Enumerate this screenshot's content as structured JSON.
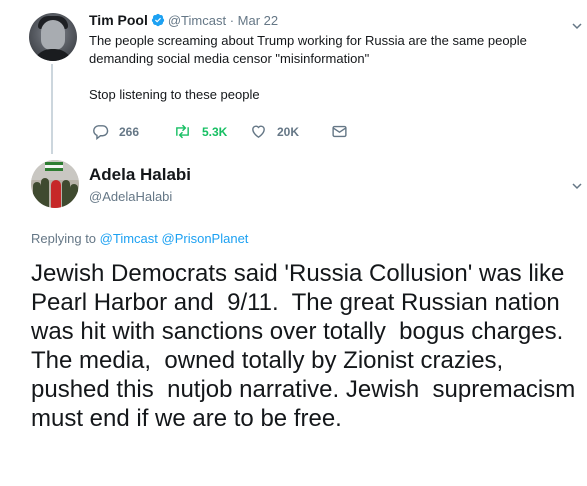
{
  "parent_tweet": {
    "author_name": "Tim Pool",
    "handle": "@Timcast",
    "separator": "·",
    "date": "Mar 22",
    "text_line1": "The people screaming about Trump working for Russia are the same people",
    "text_line2": "demanding social media censor \"misinformation\"",
    "text_line3": "Stop listening to these people",
    "replies": "266",
    "retweets": "5.3K",
    "likes": "20K",
    "verified_color": "#1da1f2",
    "retweet_color": "#17bf63"
  },
  "reply_tweet": {
    "author_name": "Adela Halabi",
    "handle": "@AdelaHalabi",
    "replying_prefix": "Replying to",
    "replying_to_1": "@Timcast",
    "replying_to_2": "@PrisonPlanet",
    "body": "Jewish Democrats said 'Russia Collusion' was like Pearl Harbor and  9/11.  The great Russian nation was hit with sanctions over totally  bogus charges. The media,  owned totally by Zionist crazies, pushed this  nutjob narrative. Jewish  supremacism must end if we are to be free.",
    "link_color": "#1da1f2"
  },
  "icons": {
    "reply": "reply-icon",
    "retweet": "retweet-icon",
    "like": "heart-icon",
    "dm": "envelope-icon",
    "more": "chevron-down-icon",
    "verified": "verified-badge-icon"
  }
}
